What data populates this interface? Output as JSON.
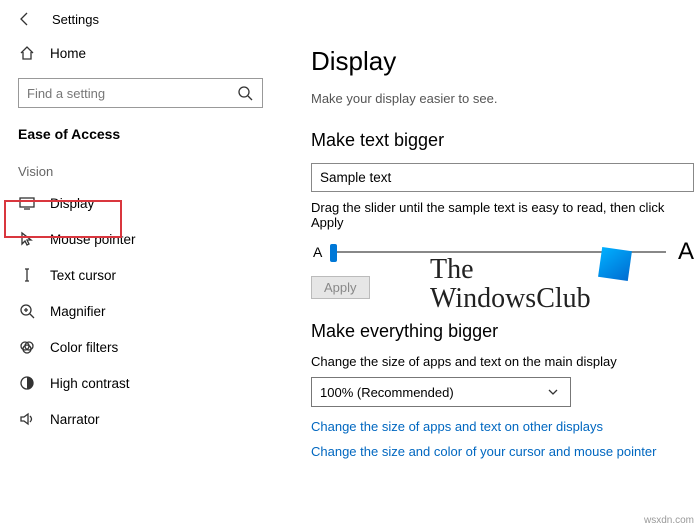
{
  "header": {
    "title": "Settings"
  },
  "sidebar": {
    "home": "Home",
    "search_placeholder": "Find a setting",
    "section": "Ease of Access",
    "group": "Vision",
    "items": [
      {
        "label": "Display"
      },
      {
        "label": "Mouse pointer"
      },
      {
        "label": "Text cursor"
      },
      {
        "label": "Magnifier"
      },
      {
        "label": "Color filters"
      },
      {
        "label": "High contrast"
      },
      {
        "label": "Narrator"
      }
    ]
  },
  "main": {
    "title": "Display",
    "subtitle": "Make your display easier to see.",
    "textbigger": {
      "heading": "Make text bigger",
      "sample": "Sample text",
      "hint": "Drag the slider until the sample text is easy to read, then click Apply",
      "small_a": "A",
      "big_a": "A",
      "apply": "Apply"
    },
    "everything": {
      "heading": "Make everything bigger",
      "desc": "Change the size of apps and text on the main display",
      "dropdown": "100% (Recommended)",
      "link1": "Change the size of apps and text on other displays",
      "link2": "Change the size and color of your cursor and mouse pointer"
    }
  },
  "watermark": {
    "line1": "The",
    "line2": "WindowsClub"
  },
  "footer": "wsxdn.com"
}
